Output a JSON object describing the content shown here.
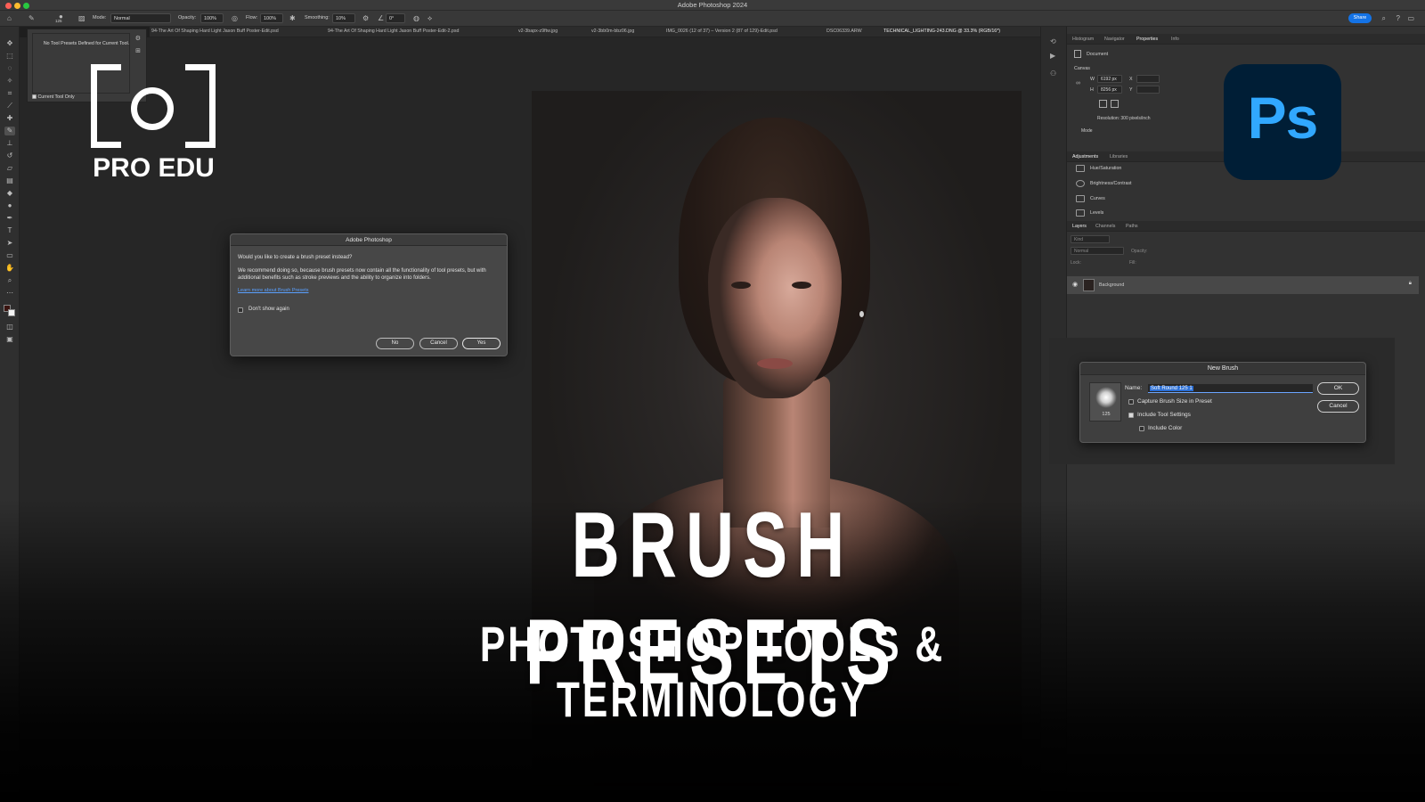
{
  "app": {
    "title": "Adobe Photoshop 2024"
  },
  "options_bar": {
    "brush_size": "125",
    "mode_label": "Mode:",
    "mode_value": "Normal",
    "opacity_label": "Opacity:",
    "opacity_value": "100%",
    "flow_label": "Flow:",
    "flow_value": "100%",
    "smoothing_label": "Smoothing:",
    "smoothing_value": "10%",
    "angle_value": "0°",
    "share_label": "Share"
  },
  "tabs": [
    "94-The Art Of Shaping Hard Light Jason Buff Poster-Edit.psd",
    "94-The Art Of Shaping Hard Light Jason Buff Poster-Edit-2.psd",
    "v2-3bapx-z9ftw.jpg",
    "v2-3bb0m-bbz06.jpg",
    "IMG_0026 (12 of 37) – Version 2 (87 of 129)-Edit.psd",
    "DSC06339.ARW",
    "TECHNICAL_LIGHTING-243.DNG @ 33.3% (RGB/16*)"
  ],
  "preset_popup": {
    "message": "No Tool Presets Defined for Current Tool.",
    "checkbox_label": "Current Tool Only"
  },
  "dialog": {
    "title": "Adobe Photoshop",
    "question": "Would you like to create a brush preset instead?",
    "body": "We recommend doing so, because brush presets now contain all the functionality of tool presets, but with additional benefits such as stroke previews and the ability to organize into folders.",
    "link": "Learn more about Brush Presets",
    "checkbox_label": "Don't show again",
    "no_label": "No",
    "cancel_label": "Cancel",
    "yes_label": "Yes"
  },
  "properties_panel": {
    "tabs": [
      "Histogram",
      "Navigator",
      "Properties",
      "Info"
    ],
    "section": "Document",
    "canvas_label": "Canvas",
    "w_label": "W",
    "w_value": "6192 px",
    "h_label": "H",
    "h_value": "8256 px",
    "x_label": "X",
    "y_label": "Y",
    "resolution": "Resolution: 300 pixels/inch",
    "mode_label": "Mode"
  },
  "adjustments_panel": {
    "tabs": [
      "Adjustments",
      "Libraries"
    ],
    "items": [
      "Hue/Saturation",
      "Brightness/Contrast",
      "Curves",
      "Levels"
    ]
  },
  "layers_panel": {
    "tabs": [
      "Layers",
      "Channels",
      "Paths"
    ],
    "search_placeholder": "Kind",
    "blend_mode": "Normal",
    "opacity_label": "Opacity:",
    "lock_label": "Lock:",
    "fill_label": "Fill:",
    "layer_name": "Background"
  },
  "new_brush": {
    "title": "New Brush",
    "name_label": "Name:",
    "name_value": "Soft Round 125 1",
    "brush_size": "125",
    "capture_label": "Capture Brush Size in Preset",
    "include_tool_label": "Include Tool Settings",
    "include_color_label": "Include Color",
    "ok_label": "OK",
    "cancel_label": "Cancel"
  },
  "branding": {
    "logo_text": "PRO EDU",
    "ps_logo": "Ps",
    "headline": "BRUSH PRESETS",
    "subhead": "PHOTOSHOP TOOLS & TERMINOLOGY"
  },
  "colors": {
    "accent_blue": "#1473e6",
    "ps_logo_bg": "#001e36",
    "ps_logo_fg": "#31a8ff",
    "ui_dark": "#323232"
  }
}
